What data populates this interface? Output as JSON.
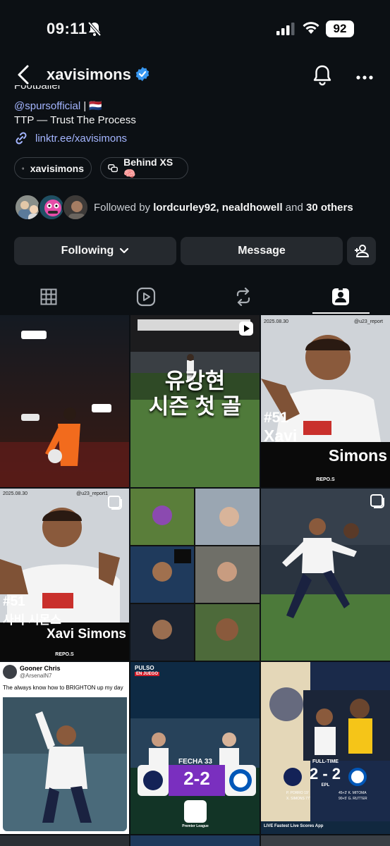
{
  "status": {
    "time": "09:11",
    "battery": "92"
  },
  "nav": {
    "username": "xavisimons"
  },
  "bio": {
    "clipped_line": "Footballer",
    "mention": "@spursofficial",
    "mention_suffix": "| 🇳🇱",
    "tagline": "TTP — Trust The Process",
    "link": "linktr.ee/xavisimons"
  },
  "chips": {
    "threads": "xavisimons",
    "channel": "Behind XS 🧠"
  },
  "followed": {
    "prefix": "Followed by ",
    "names": "lordcurley92, nealdhowell",
    "middle": " and ",
    "others": "30 others"
  },
  "buttons": {
    "following": "Following",
    "message": "Message"
  },
  "grid": {
    "post2_title_line1": "유강현",
    "post2_title_line2": "시즌 첫 골",
    "post3_number": "#51",
    "post3_first": "Xavi",
    "post3_last": "Simons",
    "post3_date": "2025.08.30",
    "post3_handle": "@u23_report",
    "post3_brand": "REPO.S",
    "post4_date": "2025.08.30",
    "post4_handle": "@u23_report1",
    "post4_number": "#51",
    "post4_korean": "사비 시몬스",
    "post4_name": "Xavi Simons",
    "post4_brand": "REPO.S",
    "post7_author": "Gooner Chris",
    "post7_handle": "@ArsenalN7",
    "post7_text": "The always know how to BRIGHTON up my day",
    "post8_brand": "PULSO",
    "post8_live": "EN JUEGO",
    "post8_fecha": "FECHA 33",
    "post8_score": "2-2",
    "post8_league": "Premier League",
    "post9_status": "FULL-TIME",
    "post9_score": "2 - 2",
    "post9_league": "EPL",
    "post9_scorers_home": "P. PORRO 19'\nX. SIMONS 77'",
    "post9_scorers_away": "45+3' K. MITOMA\n90+5' G. RUTTER",
    "post9_banner": "LIVE  Fastest Live Scores App"
  },
  "colors": {
    "background": "#0c1014",
    "button": "#25292e",
    "link": "#a4b5ff",
    "verified": "#3897f0"
  }
}
